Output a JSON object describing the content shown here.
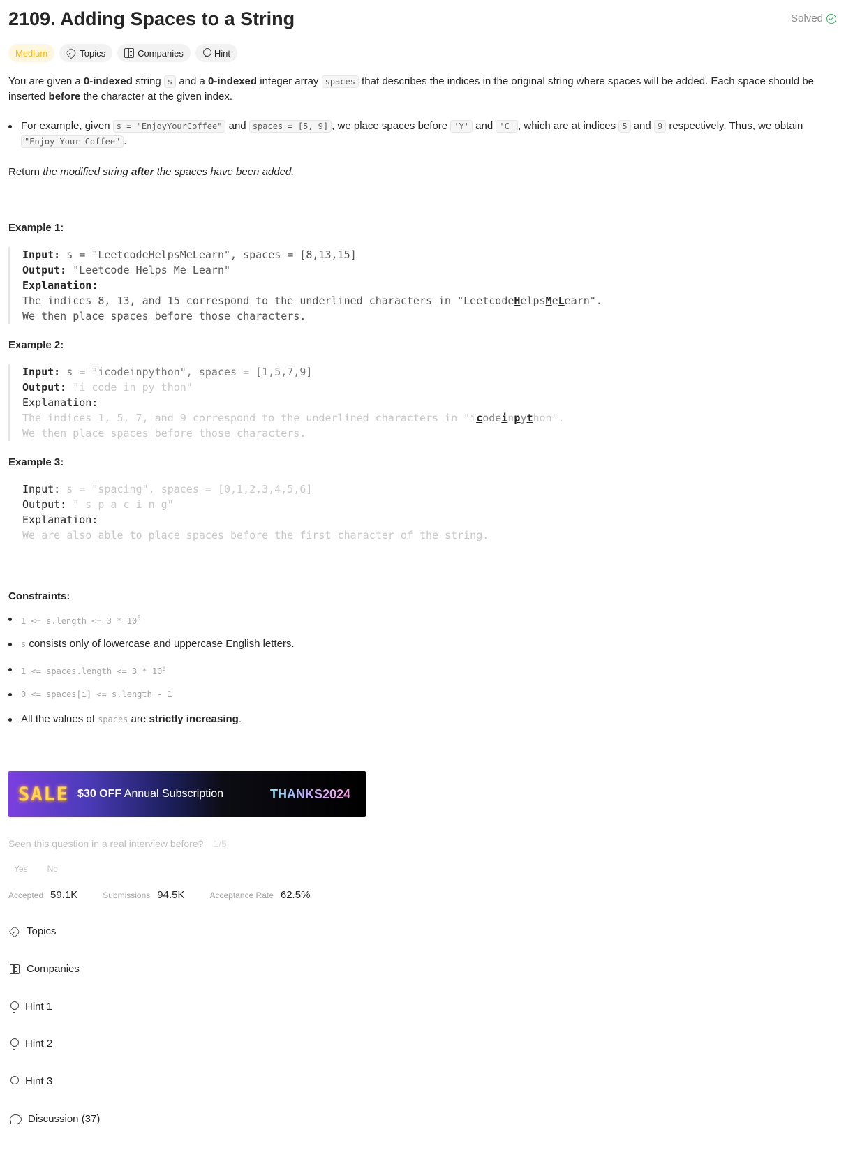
{
  "header": {
    "title": "2109. Adding Spaces to a String",
    "status": "Solved"
  },
  "tags": {
    "difficulty": "Medium",
    "topics": "Topics",
    "companies": "Companies",
    "hint": "Hint"
  },
  "description": {
    "p1": [
      "You are given a ",
      "0-indexed",
      " string ",
      "s",
      " and a ",
      "0-indexed",
      " integer array ",
      "spaces",
      " that describes the indices in the original string where spaces will be added. Each space should be inserted ",
      "before",
      " the character at the given index."
    ],
    "bullet": [
      "For example, given ",
      "s = \"EnjoyYourCoffee\"",
      " and ",
      "spaces = [5, 9]",
      ", we place spaces before ",
      "'Y'",
      " and ",
      "'C'",
      ", which are at indices ",
      "5",
      " and ",
      "9",
      " respectively. Thus, we obtain ",
      "\"Enjoy Your Coffee\"",
      "."
    ],
    "return": [
      "Return ",
      "the modified string ",
      "after",
      " the spaces have been added."
    ]
  },
  "examples": [
    {
      "label": "Example 1:",
      "input_key": "Input:",
      "input": " s = \"LeetcodeHelpsMeLearn\", spaces = [8,13,15]",
      "output_key": "Output:",
      "output": " \"Leetcode Helps Me Learn\"",
      "explanation_key": "Explanation:",
      "line1_pre": "The indices 8, 13, and 15 correspond to the underlined characters in \"Leetcode",
      "line1_parts": [
        "H",
        "elps",
        "M",
        "e",
        "L",
        "earn\"."
      ],
      "line2": "We then place spaces before those characters."
    },
    {
      "label": "Example 2:",
      "input_key": "Input:",
      "input": " s = \"icodeinpython\", spaces = [1,5,7,9]",
      "output_key": "Output:",
      "output": " \"i code in py thon\"",
      "explanation_key": "Explanation:",
      "line1_pre": "The indices 1, 5, 7, and 9 correspond to the underlined characters in \"i",
      "line1_parts": [
        "c",
        "ode",
        "i",
        "n",
        "p",
        "y",
        "t",
        "hon\"."
      ],
      "line2": "We then place spaces before those characters."
    },
    {
      "label": "Example 3:",
      "input_key": "Input:",
      "input": " s = \"spacing\", spaces = [0,1,2,3,4,5,6]",
      "output_key": "Output:",
      "output": " \" s p a c i n g\"",
      "explanation_key": "Explanation:",
      "line1": "We are also able to place spaces before the first character of the string."
    }
  ],
  "constraints": {
    "label": "Constraints:",
    "items": [
      {
        "mono": "1 <= s.length <= 3 * 10",
        "sup": "5"
      },
      {
        "mono": "s",
        "text": " consists only of lowercase and uppercase English letters."
      },
      {
        "mono": "1 <= spaces.length <= 3 * 10",
        "sup": "5"
      },
      {
        "mono": "0 <= spaces[i] <= s.length - 1"
      },
      {
        "pre": "All the values of ",
        "mono": "spaces",
        "mid": " are ",
        "bold": "strictly increasing",
        "post": "."
      }
    ]
  },
  "banner": {
    "sale": "SALE",
    "offer_bold": "$30 OFF",
    "offer_rest": " Annual Subscription",
    "code": "THANKS2024"
  },
  "feedback": {
    "question": "Seen this question in a real interview before?",
    "score": "1/5",
    "yes": "Yes",
    "no": "No"
  },
  "stats": {
    "accepted_label": "Accepted",
    "accepted": "59.1K",
    "submissions_label": "Submissions",
    "submissions": "94.5K",
    "rate_label": "Acceptance Rate",
    "rate": "62.5%"
  },
  "sections": {
    "topics": "Topics",
    "companies": "Companies",
    "hint1": "Hint 1",
    "hint2": "Hint 2",
    "hint3": "Hint 3",
    "discussion": "Discussion (37)"
  }
}
